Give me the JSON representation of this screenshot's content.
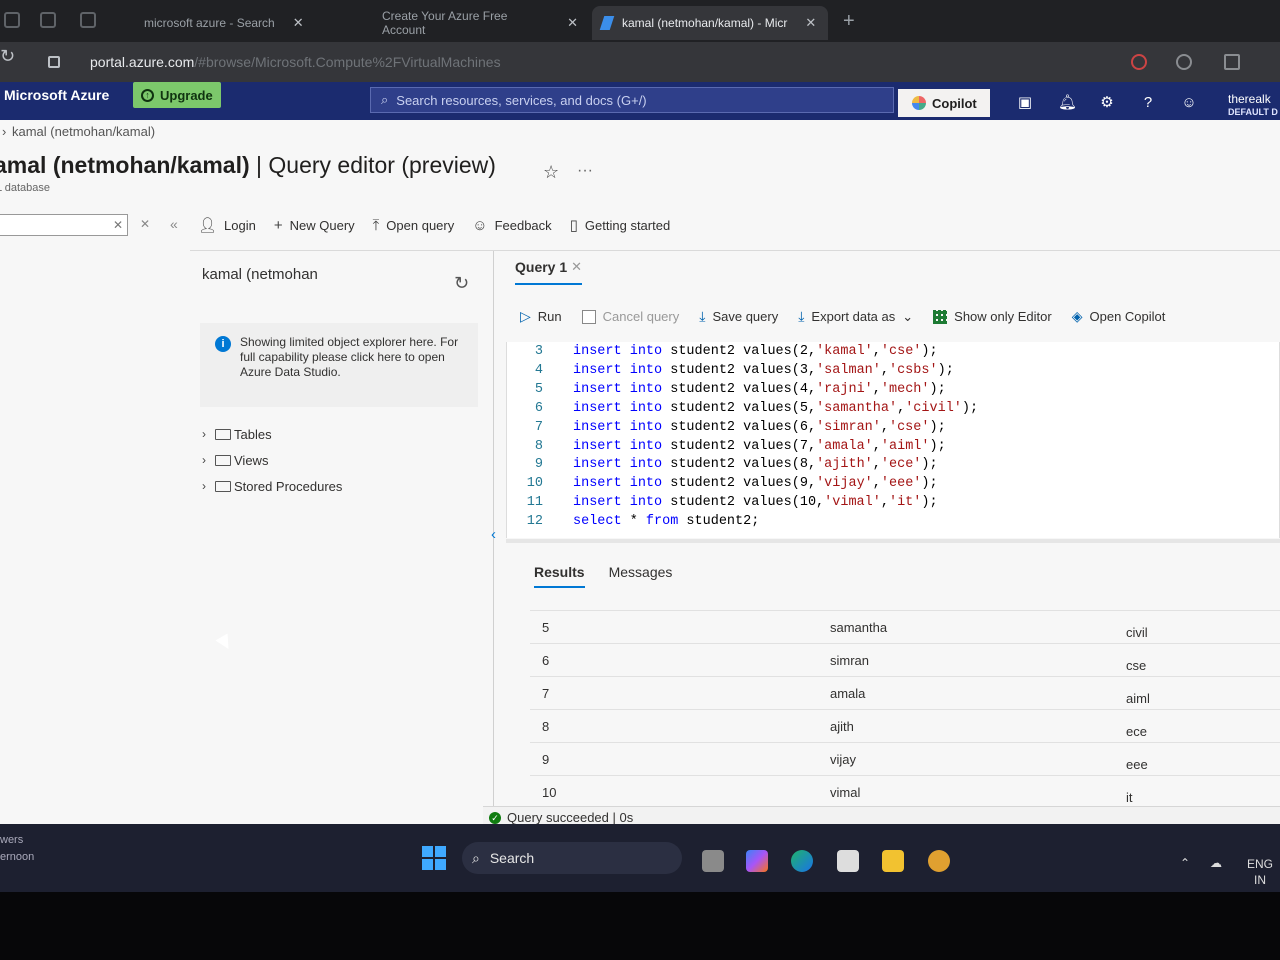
{
  "browser": {
    "tabs": [
      {
        "title": "microsoft azure - Search"
      },
      {
        "title": "Create Your Azure Free Account"
      },
      {
        "title": "kamal (netmohan/kamal) - Micr"
      }
    ],
    "url_host": "portal.azure.com",
    "url_path": "/#browse/Microsoft.Compute%2FVirtualMachines"
  },
  "header": {
    "brand": "Microsoft Azure",
    "upgrade_label": "Upgrade",
    "search_placeholder": "Search resources, services, and docs (G+/)",
    "copilot_label": "Copilot",
    "account_name": "therealk",
    "account_dir": "DEFAULT D"
  },
  "page": {
    "breadcrumb": "kamal (netmohan/kamal)",
    "title_bold": "amal (netmohan/kamal)",
    "title_rest": " | Query editor (preview)",
    "subtitle": "L database"
  },
  "toolbar": {
    "login": "Login",
    "new_query": "New Query",
    "open_query": "Open query",
    "feedback": "Feedback",
    "getting_started": "Getting started"
  },
  "explorer": {
    "db_name": "kamal (netmohan",
    "info_text": "Showing limited object explorer here. For full capability please click here to open Azure Data Studio.",
    "tree": [
      {
        "label": "Tables"
      },
      {
        "label": "Views"
      },
      {
        "label": "Stored Procedures"
      }
    ]
  },
  "query": {
    "tab_label": "Query 1",
    "run": "Run",
    "cancel": "Cancel query",
    "save": "Save query",
    "export": "Export data as",
    "show_only_editor": "Show only Editor",
    "open_copilot": "Open Copilot",
    "lines": [
      {
        "n": "3",
        "id": "2",
        "name": "'kamal'",
        "dept": "'cse'"
      },
      {
        "n": "4",
        "id": "3",
        "name": "'salman'",
        "dept": "'csbs'"
      },
      {
        "n": "5",
        "id": "4",
        "name": "'rajni'",
        "dept": "'mech'"
      },
      {
        "n": "6",
        "id": "5",
        "name": "'samantha'",
        "dept": "'civil'"
      },
      {
        "n": "7",
        "id": "6",
        "name": "'simran'",
        "dept": "'cse'"
      },
      {
        "n": "8",
        "id": "7",
        "name": "'amala'",
        "dept": "'aiml'"
      },
      {
        "n": "9",
        "id": "8",
        "name": "'ajith'",
        "dept": "'ece'"
      },
      {
        "n": "10",
        "id": "9",
        "name": "'vijay'",
        "dept": "'eee'"
      },
      {
        "n": "11",
        "id": "10",
        "name": "'vimal'",
        "dept": "'it'"
      }
    ],
    "select_line": {
      "n": "12",
      "kw1": "select",
      "star": " * ",
      "kw2": "from",
      "rest": " student2;"
    },
    "insert_kw": "insert",
    "into_kw": "into",
    "table": "student2",
    "values_kw": "values"
  },
  "results": {
    "tabs": [
      "Results",
      "Messages"
    ],
    "rows": [
      [
        "5",
        "samantha",
        "civil"
      ],
      [
        "6",
        "simran",
        "cse"
      ],
      [
        "7",
        "amala",
        "aiml"
      ],
      [
        "8",
        "ajith",
        "ece"
      ],
      [
        "9",
        "vijay",
        "eee"
      ],
      [
        "10",
        "vimal",
        "it"
      ]
    ],
    "status": "Query succeeded | 0s"
  },
  "taskbar": {
    "left_line1": "wers",
    "left_line2": "ernoon",
    "search_label": "Search",
    "lang1": "ENG",
    "lang2": "IN"
  }
}
